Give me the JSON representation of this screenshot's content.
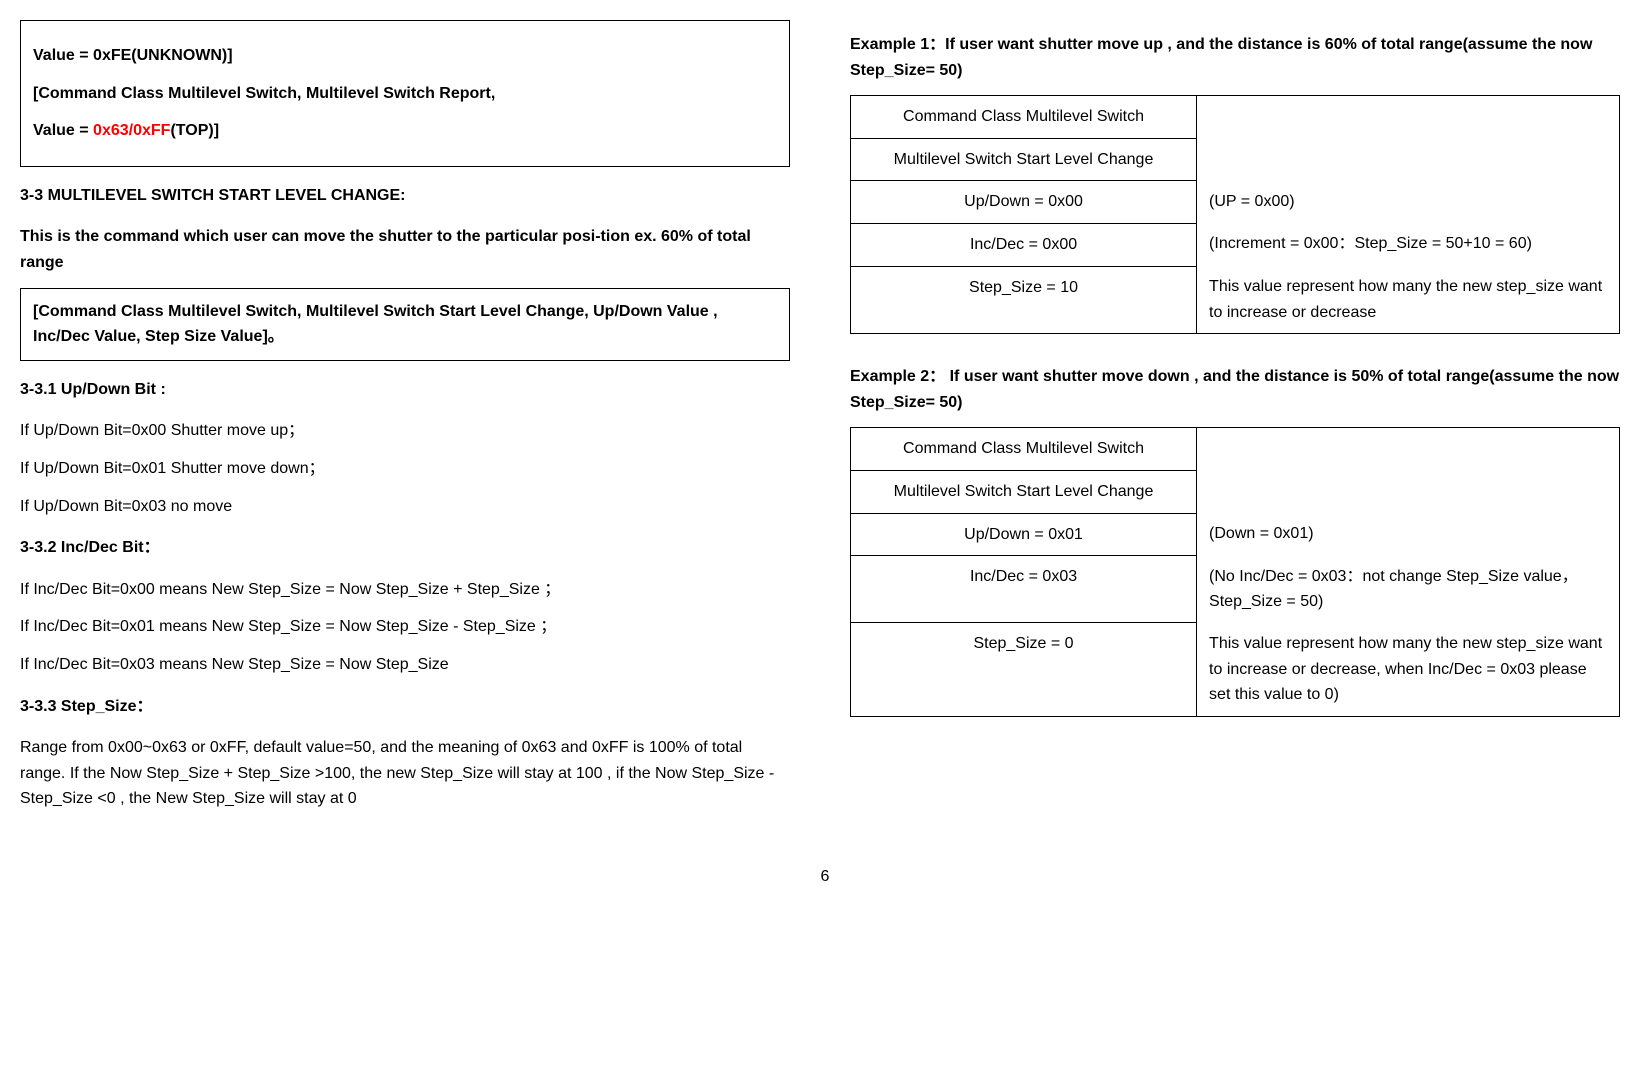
{
  "leftCol": {
    "box1": {
      "line1": "Value = 0xFE(UNKNOWN)]",
      "line2": "[Command Class Multilevel Switch, Multilevel Switch Report,",
      "line3_prefix": "Value = ",
      "line3_red": "0x63/0xFF",
      "line3_suffix": "(TOP)]"
    },
    "sectionTitle33": "3-3 MULTILEVEL SWITCH START LEVEL CHANGE:",
    "intro33": "This is the command which user can move the shutter to the particular posi-tion ex. 60% of total range",
    "box2": {
      "line1": "[Command Class Multilevel Switch, Multilevel Switch Start Level Change, Up/Down Value , Inc/Dec Value, Step Size Value]。"
    },
    "sub331": "3-3.1 Up/Down Bit :",
    "sub331_l1": "If Up/Down Bit=0x00 Shutter move up；",
    "sub331_l2": "If Up/Down Bit=0x01 Shutter move down；",
    "sub331_l3": "If Up/Down Bit=0x03 no move",
    "sub332": "3-3.2 Inc/Dec Bit：",
    "sub332_l1": "If Inc/Dec Bit=0x00 means New Step_Size = Now Step_Size + Step_Size  ；",
    "sub332_l2": "If Inc/Dec Bit=0x01 means New Step_Size = Now Step_Size - Step_Size  ；",
    "sub332_l3": "If Inc/Dec Bit=0x03 means New Step_Size = Now Step_Size",
    "sub333": "3-3.3 Step_Size：",
    "sub333_text": "Range from 0x00~0x63 or 0xFF, default value=50, and the meaning of 0x63 and 0xFF is 100% of total range. If the Now Step_Size + Step_Size >100, the new Step_Size will stay at 100 , if  the Now Step_Size - Step_Size <0 , the New Step_Size will stay at 0"
  },
  "rightCol": {
    "ex1Title": "Example 1：If user want shutter move up , and the distance is 60% of total range(assume the now Step_Size= 50)",
    "ex1": {
      "r1l": "Command Class Multilevel Switch",
      "r2l": "Multilevel Switch Start Level Change",
      "r3l": "Up/Down = 0x00",
      "r3r": "(UP = 0x00)",
      "r4l": "Inc/Dec = 0x00",
      "r4r": "(Increment = 0x00：Step_Size = 50+10 = 60)",
      "r5l": "Step_Size = 10",
      "r5r": "This value represent how many the new step_size want to increase or decrease"
    },
    "ex2Title": "Example 2： If user want shutter move down , and the distance is 50% of total range(assume the now Step_Size= 50)",
    "ex2": {
      "r1l": "Command Class Multilevel Switch",
      "r2l": "Multilevel Switch Start Level Change",
      "r3l": "Up/Down = 0x01",
      "r3r": "(Down = 0x01)",
      "r4l": "Inc/Dec = 0x03",
      "r4r": "(No Inc/Dec = 0x03：not change Step_Size value，Step_Size = 50)",
      "r5l": "Step_Size = 0",
      "r5r": "This value represent how many the new step_size want to increase or decrease, when Inc/Dec = 0x03 please set this value to 0)"
    }
  },
  "pageNumber": "6"
}
